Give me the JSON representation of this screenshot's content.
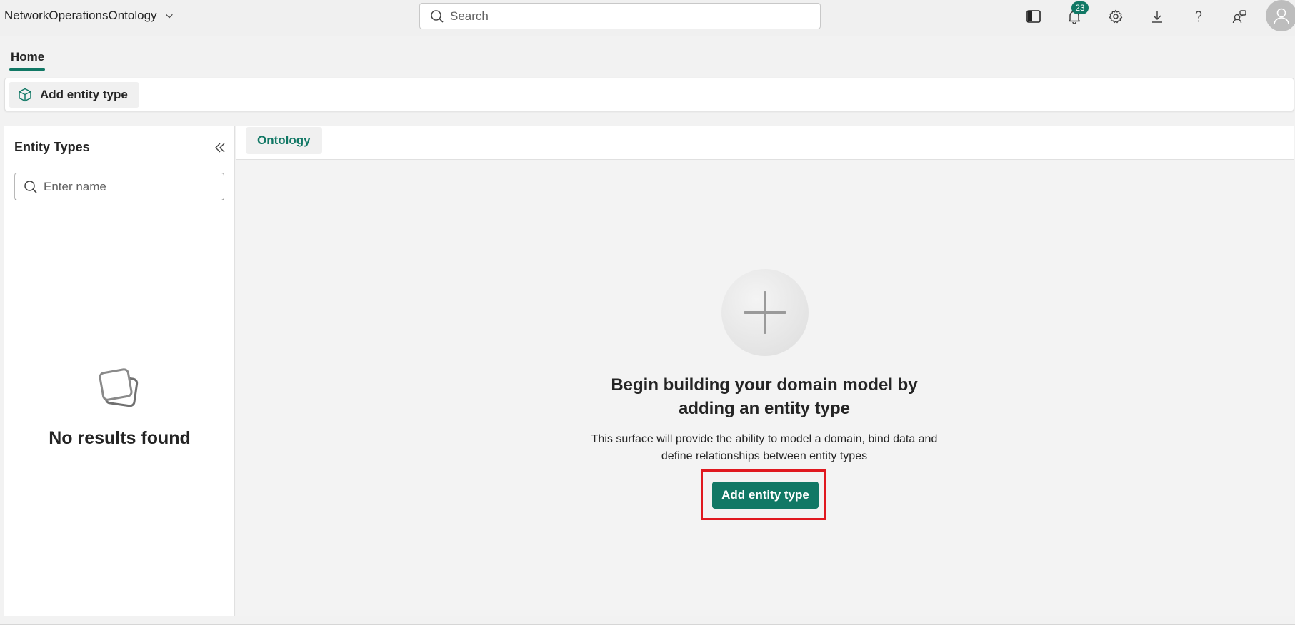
{
  "topbar": {
    "app_title": "NetworkOperationsOntology",
    "search_placeholder": "Search",
    "notification_count": "23",
    "icons": [
      "panel-toggle-icon",
      "bell-icon",
      "gear-icon",
      "download-icon",
      "help-icon",
      "share-feedback-icon",
      "avatar-icon"
    ]
  },
  "tabs": {
    "home": "Home"
  },
  "ribbon": {
    "add_entity_label": "Add entity type"
  },
  "left_panel": {
    "title": "Entity Types",
    "search_placeholder": "Enter name",
    "empty_text": "No results found"
  },
  "main": {
    "tab_label": "Ontology",
    "empty_heading": "Begin building your domain model by adding an entity type",
    "empty_description": "This surface will provide the ability to model a domain, bind data and define relationships between entity types",
    "add_button_label": "Add entity type"
  },
  "colors": {
    "accent": "#117865",
    "highlight": "#e0181f"
  }
}
